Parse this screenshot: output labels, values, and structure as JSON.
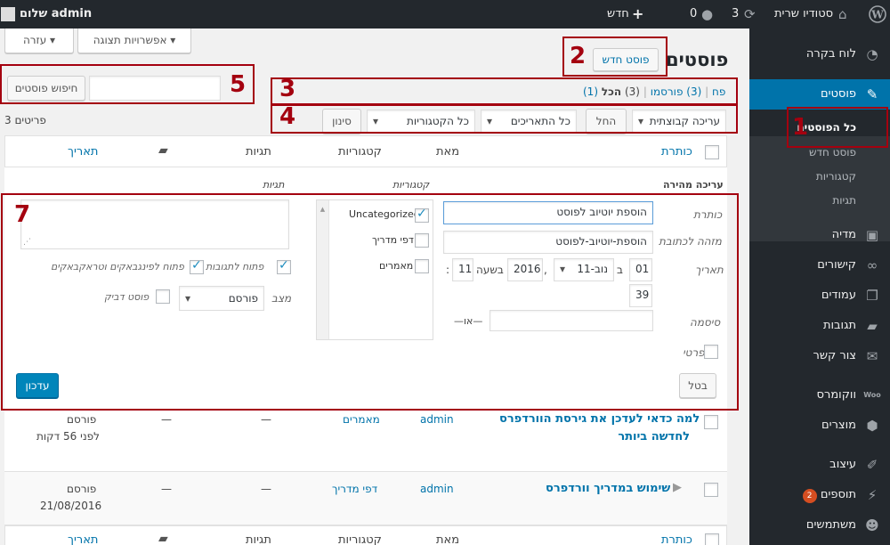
{
  "adminbar": {
    "site_name": "סטודיו שרית",
    "updates_count": "3",
    "comments_count": "0",
    "new_label": "חדש",
    "greeting": "שלום admin"
  },
  "sidebar": {
    "dashboard": "לוח בקרה",
    "posts": "פוסטים",
    "posts_sub": [
      "כל הפוסטים",
      "פוסט חדש",
      "קטגוריות",
      "תגיות"
    ],
    "media": "מדיה",
    "links": "קישורים",
    "pages": "עמודים",
    "comments": "תגובות",
    "contact": "צור קשר",
    "woocommerce": "ווקומרס",
    "products": "מוצרים",
    "appearance": "עיצוב",
    "plugins": "תוספים",
    "plugins_badge": "2",
    "users": "משתמשים"
  },
  "screen_meta": {
    "screen_options": "אפשרויות תצוגה",
    "help": "עזרה"
  },
  "header": {
    "title": "פוסטים",
    "add_new": "פוסט חדש"
  },
  "search": {
    "button": "חיפוש פוסטים",
    "value": ""
  },
  "views": {
    "all": "הכל",
    "all_count": "(3)",
    "published": "פורסמו",
    "published_count": "(3)",
    "trash": "פח",
    "trash_count": "(1)",
    "sep": "|"
  },
  "filters": {
    "bulk": "עריכה קבוצתית",
    "apply": "החל",
    "dates": "כל התאריכים",
    "cats": "כל הקטגוריות",
    "filter": "סינון",
    "items_count": "3 פריטים"
  },
  "columns": {
    "title": "כותרת",
    "author": "מאת",
    "categories": "קטגוריות",
    "tags": "תגיות",
    "date": "תאריך"
  },
  "quick_edit": {
    "heading": "עריכה מהירה",
    "cats_heading": "קטגוריות",
    "tags_heading": "תגיות",
    "title_label": "כותרת",
    "title_value": "הוספת יוטיוב לפוסט",
    "slug_label": "מזהה לכתובת",
    "slug_value": "הוספת-יוטיוב-לפוסט",
    "date_label": "תאריך",
    "day": "01",
    "at_b": "ב",
    "month": "11-נוב",
    "comma": ",",
    "year": "2016",
    "at_time": "בשעה",
    "hour": "11",
    "colon": ":",
    "minute": "39",
    "password_label": "סיסמה",
    "or_label": "—או—",
    "private_label": "פרטי",
    "categories": [
      "Uncategorized",
      "דפי מדריך",
      "מאמרים"
    ],
    "comments_open": "פתוח לתגובות",
    "pings_open": "פתוח לפינגבאקים וטראקבאקים",
    "status_label": "מצב",
    "status_value": "פורסם",
    "sticky_label": "פוסט דביק",
    "cancel": "בטל",
    "update": "עדכון"
  },
  "rows": [
    {
      "title_line1": "למה כדאי לעדכן את גירסת הוורדפרס",
      "title_line2": "לחדשה ביותר",
      "author": "admin",
      "category": "מאמרים",
      "tags": "—",
      "comments": "—",
      "status": "פורסם",
      "date": "לפני 56 דקות"
    },
    {
      "title_line1": "שימוש במדריך וורדפרס",
      "author": "admin",
      "category": "דפי מדריך",
      "tags": "—",
      "comments": "—",
      "status": "פורסם",
      "date": "21/08/2016"
    }
  ],
  "annotations": [
    "1",
    "2",
    "3",
    "4",
    "5",
    "7"
  ],
  "colors": {
    "adminbar": "#23282d",
    "accent": "#0073aa",
    "annotation": "#a4000f",
    "badge": "#d54e21"
  }
}
